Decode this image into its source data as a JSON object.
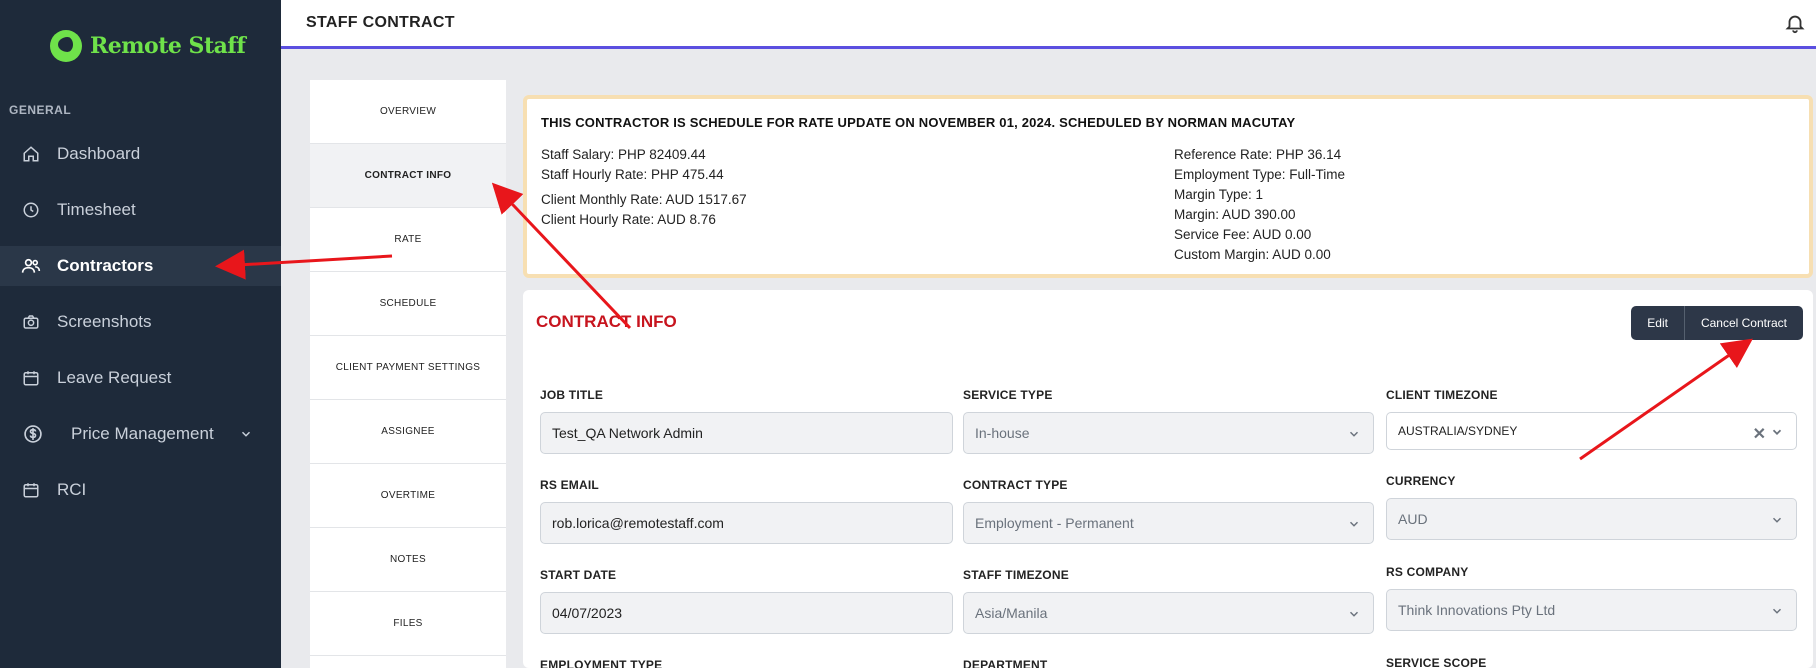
{
  "app": {
    "brand": "Remote Staff",
    "brand_color": "#6fe24a",
    "accent": "#5b4fe0"
  },
  "sidebar": {
    "section": "GENERAL",
    "items": [
      {
        "label": "Dashboard",
        "icon": "home-icon"
      },
      {
        "label": "Timesheet",
        "icon": "clock-icon"
      },
      {
        "label": "Contractors",
        "icon": "users-icon",
        "active": true
      },
      {
        "label": "Screenshots",
        "icon": "camera-icon"
      },
      {
        "label": "Leave Request",
        "icon": "calendar-icon"
      },
      {
        "label": "Price Management",
        "icon": "dollar-icon"
      },
      {
        "label": "RCI",
        "icon": "calendar-icon"
      }
    ]
  },
  "header": {
    "title": "STAFF CONTRACT"
  },
  "tabs": [
    "OVERVIEW",
    "CONTRACT INFO",
    "RATE",
    "SCHEDULE",
    "CLIENT PAYMENT SETTINGS",
    "ASSIGNEE",
    "OVERTIME",
    "NOTES",
    "FILES"
  ],
  "alert": {
    "title": "THIS CONTRACTOR IS SCHEDULE FOR RATE UPDATE ON NOVEMBER 01, 2024. SCHEDULED BY NORMAN MACUTAY",
    "left": {
      "staff_salary": "Staff Salary: PHP 82409.44",
      "staff_hourly": "Staff Hourly Rate: PHP 475.44",
      "client_monthly": "Client Monthly Rate: AUD 1517.67",
      "client_hourly": "Client Hourly Rate: AUD 8.76"
    },
    "right": {
      "reference_rate": "Reference Rate: PHP 36.14",
      "employment_type": "Employment Type: Full-Time",
      "margin_type": "Margin Type: 1",
      "margin": "Margin: AUD 390.00",
      "service_fee": "Service Fee: AUD 0.00",
      "custom_margin": "Custom Margin: AUD 0.00"
    }
  },
  "contract": {
    "title": "CONTRACT INFO",
    "edit_label": "Edit",
    "cancel_label": "Cancel Contract",
    "fields": {
      "job_title": {
        "label": "JOB TITLE",
        "value": "Test_QA Network Admin"
      },
      "service_type": {
        "label": "SERVICE TYPE",
        "value": "In-house"
      },
      "client_timezone": {
        "label": "CLIENT TIMEZONE",
        "value": "AUSTRALIA/SYDNEY"
      },
      "rs_email": {
        "label": "RS EMAIL",
        "value": "rob.lorica@remotestaff.com"
      },
      "contract_type": {
        "label": "CONTRACT TYPE",
        "value": "Employment - Permanent"
      },
      "currency": {
        "label": "CURRENCY",
        "value": "AUD"
      },
      "start_date": {
        "label": "START DATE",
        "value": "04/07/2023"
      },
      "staff_timezone": {
        "label": "STAFF TIMEZONE",
        "value": "Asia/Manila"
      },
      "rs_company": {
        "label": "RS COMPANY",
        "value": "Think Innovations Pty Ltd"
      },
      "employment_type": {
        "label": "EMPLOYMENT TYPE"
      },
      "department": {
        "label": "DEPARTMENT"
      },
      "service_scope": {
        "label": "SERVICE SCOPE"
      }
    }
  },
  "annotation_color": "#e8161b"
}
